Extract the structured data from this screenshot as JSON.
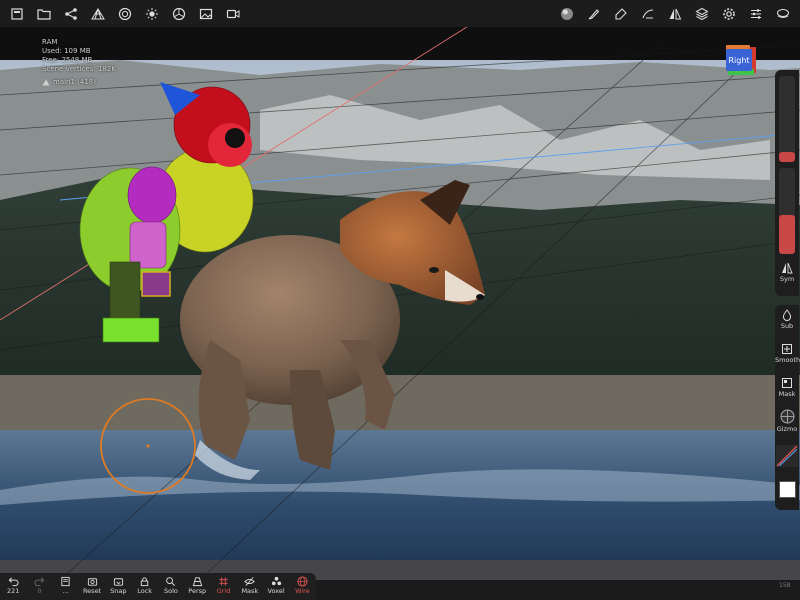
{
  "top_toolbar": {
    "left_tools": [
      {
        "name": "menu-icon"
      },
      {
        "name": "folder-icon"
      },
      {
        "name": "scene-tree-icon"
      },
      {
        "name": "topology-icon"
      },
      {
        "name": "shading-icon"
      },
      {
        "name": "light-icon"
      },
      {
        "name": "render-icon"
      },
      {
        "name": "image-icon"
      },
      {
        "name": "video-icon"
      }
    ],
    "right_tools": [
      {
        "name": "material-sphere-icon"
      },
      {
        "name": "brush-icon"
      },
      {
        "name": "paint-icon"
      },
      {
        "name": "stroke-icon"
      },
      {
        "name": "symmetry-icon"
      },
      {
        "name": "layers-icon"
      },
      {
        "name": "settings-icon"
      },
      {
        "name": "sliders-icon"
      },
      {
        "name": "more-icon"
      }
    ]
  },
  "stats": {
    "ram_label": "RAM",
    "used": "Used: 109 MB",
    "free": "Free: 2548 MB",
    "vertices": "Scene vertices: 182K",
    "mesh": "main1 (418)"
  },
  "viewcube": {
    "label": "Right"
  },
  "right_panel": {
    "radius_level": 0.12,
    "intensity_level": 0.45,
    "tools": [
      {
        "name": "sym",
        "label": "Sym"
      },
      {
        "name": "sub",
        "label": "Sub"
      },
      {
        "name": "smooth",
        "label": "Smooth"
      },
      {
        "name": "mask",
        "label": "Mask"
      },
      {
        "name": "gizmo",
        "label": "Gizmo"
      }
    ]
  },
  "bottom_bar": [
    {
      "name": "undo",
      "label": "221"
    },
    {
      "name": "redo",
      "label": "0"
    },
    {
      "name": "history",
      "label": "..."
    },
    {
      "name": "reset",
      "label": "Reset"
    },
    {
      "name": "snap",
      "label": "Snap"
    },
    {
      "name": "lock",
      "label": "Lock"
    },
    {
      "name": "solo",
      "label": "Solo"
    },
    {
      "name": "persp",
      "label": "Persp"
    },
    {
      "name": "grid",
      "label": "Grid"
    },
    {
      "name": "mask",
      "label": "Mask"
    },
    {
      "name": "voxel",
      "label": "Voxel"
    },
    {
      "name": "wire",
      "label": "Wire"
    }
  ],
  "colors": {
    "active": "#e05353",
    "brush_ring": "#e07b22",
    "accent_blue": "#3a63d6"
  },
  "fps": "158"
}
